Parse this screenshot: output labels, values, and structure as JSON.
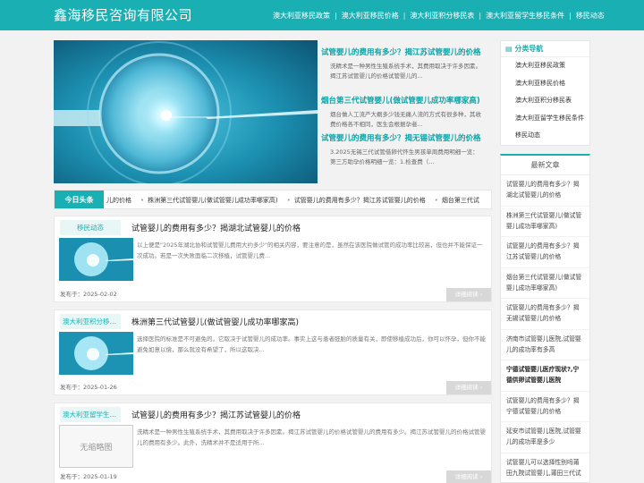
{
  "header": {
    "logo": "鑫海移民咨询有限公司",
    "nav": [
      "澳大利亚移民政策",
      "澳大利亚移民价格",
      "澳大利亚积分移民表",
      "澳大利亚留学生移民条件",
      "移民动态"
    ]
  },
  "featured": [
    {
      "title": "试管婴儿的费用有多少？揭江苏试管婴儿的价格",
      "desc": "洗精术是一种男性生殖系统手术，其费用取决于许多因素。揭江苏试管婴儿的价格试管婴儿的..."
    },
    {
      "title": "烟台第三代试管婴儿(做试管婴儿成功率哪家高)",
      "desc": "烟台做人工流产大概多少钱无痛人流的方式有很多种，其收费价格各不相同，医生会根据孕者..."
    },
    {
      "title": "试管婴儿的费用有多少？揭无锡试管婴儿的价格",
      "desc": "3.2025无锡三代试管借卵代怀生男孩单周费用明细一览：第三方助孕价格明细一览：1.检查费（..."
    }
  ],
  "ticker": {
    "label": "今日头条",
    "items": [
      "儿的价格",
      "株洲第三代试管婴儿(做试管婴儿成功率哪家高)",
      "试管婴儿的费用有多少？揭江苏试管婴儿的价格",
      "烟台第三代试"
    ]
  },
  "articles": [
    {
      "category": "移民动态",
      "title": "试管婴儿的费用有多少？揭湖北试管婴儿的价格",
      "excerpt": "以上便是\"2025年湖北协和试管婴儿费用大约多少\"的相关内容，要注意的是，虽然在该医院做试管的成功率比较高，但也并不能保证一次成功。若是一次失败面临二次移植，试管婴儿费...",
      "date_label": "发布于：",
      "date": "2025-02-02",
      "more": "详细阅读"
    },
    {
      "category": "澳大利亚积分移民表",
      "title": "株洲第三代试管婴儿(做试管婴儿成功率哪家高)",
      "excerpt": "选择医院的标准是不可避免的，它取决于试管婴儿的成功率。事实上这与患者胚胎的质量有关，即使移植成功后，你可以怀孕，但你不能避免如意以偿，那么就没有希望了，所以这取决...",
      "date_label": "发布于：",
      "date": "2025-01-26",
      "more": "详细阅读"
    },
    {
      "category": "澳大利亚留学生移民条件",
      "title": "试管婴儿的费用有多少？揭江苏试管婴儿的价格",
      "excerpt": "洗精术是一种男性生殖系统手术，其费用取决于许多因素。揭江苏试管婴儿的价格试管婴儿的费用有多少。揭江苏试管婴儿的价格试管婴儿的费用有多少。此外，洗精术并不是适用于所...",
      "date_label": "发布于：",
      "date": "2025-01-19",
      "more": "详细阅读",
      "thumb_text": "无缩略图"
    }
  ],
  "sidebar": {
    "nav_title": "分类导航",
    "nav_items": [
      "澳大利亚移民政策",
      "澳大利亚移民价格",
      "澳大利亚积分移民表",
      "澳大利亚留学生移民条件",
      "移民动态"
    ],
    "latest_title": "最新文章",
    "latest": [
      "试管婴儿的费用有多少？揭湖北试管婴儿的价格",
      "株洲第三代试管婴儿(做试管婴儿成功率哪家高)",
      "试管婴儿的费用有多少？揭江苏试管婴儿的价格",
      "烟台第三代试管婴儿(做试管婴儿成功率哪家高)",
      "试管婴儿的费用有多少？揭无锡试管婴儿的价格",
      "济南市试管婴儿医院,试管婴儿的成功率有多高",
      "宁德试管婴儿医疗现状?,宁德供卵试管婴儿医院",
      "试管婴儿的费用有多少？揭宁德试管婴儿的价格",
      "延安市试管婴儿医院,试管婴儿的成功率是多少",
      "试管婴儿可以选择性别吗莆田九院试管婴儿,莆田三代试"
    ]
  },
  "colors": {
    "accent": "#1ab0b3",
    "hero_bg": "#126d8c"
  }
}
